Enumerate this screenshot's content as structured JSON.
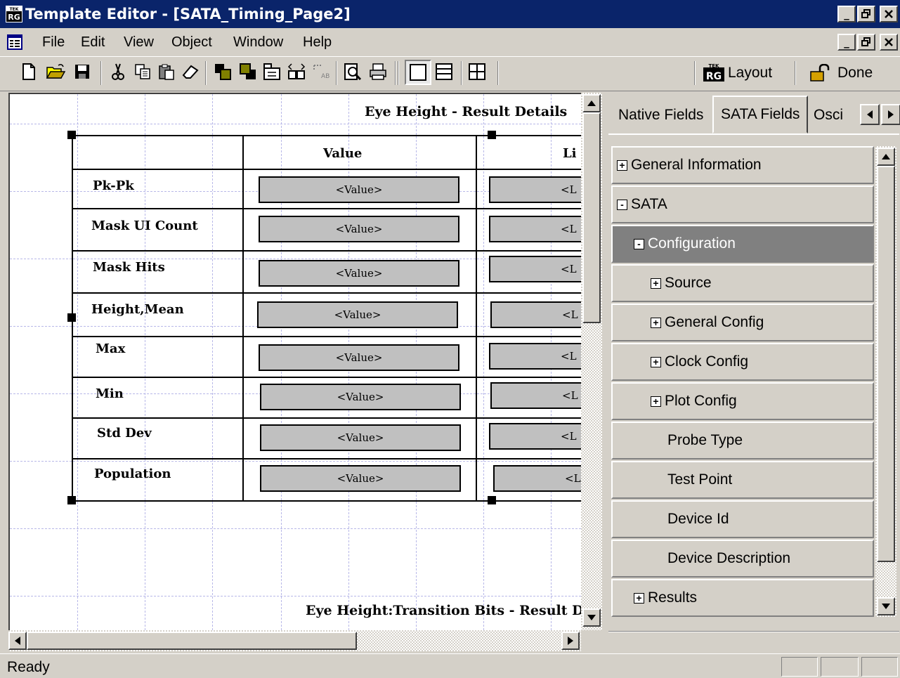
{
  "window": {
    "title": "Template Editor - [SATA_Timing_Page2]",
    "app_icon": "rg-app-icon",
    "controls": [
      "_",
      "🗗",
      "X"
    ]
  },
  "menu": {
    "items": [
      "File",
      "Edit",
      "View",
      "Object",
      "Window",
      "Help"
    ]
  },
  "toolbar": {
    "buttons": [
      "new-icon",
      "open-icon",
      "save-icon",
      "cut-icon",
      "copy-icon",
      "paste-icon",
      "erase-icon",
      "bring-front-icon",
      "send-back-icon",
      "group-icon",
      "align-icon",
      "field-icon",
      "preview-icon",
      "print-icon",
      "single-layout-icon",
      "rows-layout-icon",
      "grid-layout-icon"
    ],
    "layout_label": "Layout",
    "done_label": "Done"
  },
  "canvas": {
    "heading_top": "Eye Height - Result Details",
    "heading_bottom": "Eye Height:Transition Bits - Result D",
    "table": {
      "col_value": "Value",
      "col_limit": "Li",
      "rows": [
        {
          "label": "Pk-Pk",
          "value": "<Value>",
          "limit": "<L"
        },
        {
          "label": "Mask UI Count",
          "value": "<Value>",
          "limit": "<L"
        },
        {
          "label": "Mask Hits",
          "value": "<Value>",
          "limit": "<L"
        },
        {
          "label": "Height,Mean",
          "value": "<Value>",
          "limit": "<L"
        },
        {
          "label": "Max",
          "value": "<Value>",
          "limit": "<L"
        },
        {
          "label": "Min",
          "value": "<Value>",
          "limit": "<L"
        },
        {
          "label": "Std Dev",
          "value": "<Value>",
          "limit": "<L"
        },
        {
          "label": "Population",
          "value": "<Value>",
          "limit": "<L"
        }
      ]
    }
  },
  "panel": {
    "tabs": [
      "Native Fields",
      "SATA Fields",
      "Osci"
    ],
    "active_tab": "SATA Fields",
    "tree": [
      {
        "label": "General Information",
        "expander": "+",
        "level": 0
      },
      {
        "label": "SATA",
        "expander": "-",
        "level": 0
      },
      {
        "label": "Configuration",
        "expander": "-",
        "level": 1,
        "selected": true
      },
      {
        "label": "Source",
        "expander": "+",
        "level": 2
      },
      {
        "label": "General Config",
        "expander": "+",
        "level": 2
      },
      {
        "label": "Clock Config",
        "expander": "+",
        "level": 2
      },
      {
        "label": "Plot Config",
        "expander": "+",
        "level": 2
      },
      {
        "label": "Probe Type",
        "expander": "",
        "level": 3
      },
      {
        "label": "Test Point",
        "expander": "",
        "level": 3
      },
      {
        "label": "Device Id",
        "expander": "",
        "level": 3
      },
      {
        "label": "Device Description",
        "expander": "",
        "level": 3
      },
      {
        "label": "Results",
        "expander": "+",
        "level": 1
      }
    ]
  },
  "status": {
    "text": "Ready"
  }
}
